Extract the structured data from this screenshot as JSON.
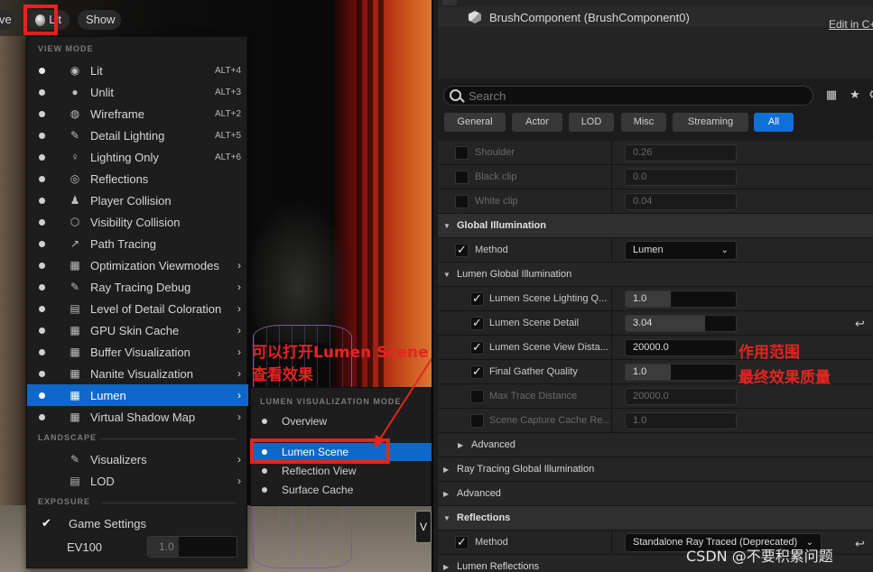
{
  "viewport": {
    "prev_label": "ve",
    "lit_label": "Lit",
    "show_label": "Show",
    "partial_button": "V"
  },
  "viewmode_menu": {
    "section_view_mode": "VIEW MODE",
    "items": [
      {
        "label": "Lit",
        "shortcut": "ALT+4",
        "icon": "sphere-icon"
      },
      {
        "label": "Unlit",
        "shortcut": "ALT+3",
        "icon": "circle-icon"
      },
      {
        "label": "Wireframe",
        "shortcut": "ALT+2",
        "icon": "globe-wire-icon"
      },
      {
        "label": "Detail Lighting",
        "shortcut": "ALT+5",
        "icon": "brush-icon"
      },
      {
        "label": "Lighting Only",
        "shortcut": "ALT+6",
        "icon": "bulb-icon"
      },
      {
        "label": "Reflections",
        "icon": "reflection-icon"
      },
      {
        "label": "Player Collision",
        "icon": "player-icon"
      },
      {
        "label": "Visibility Collision",
        "icon": "visibility-icon"
      },
      {
        "label": "Path Tracing",
        "icon": "path-icon"
      },
      {
        "label": "Optimization Viewmodes",
        "icon": "grid-icon"
      },
      {
        "label": "Ray Tracing Debug",
        "icon": "brush-icon"
      },
      {
        "label": "Level of Detail Coloration",
        "icon": "lod-icon"
      },
      {
        "label": "GPU Skin Cache",
        "icon": "grid-icon"
      },
      {
        "label": "Buffer Visualization",
        "icon": "grid-icon"
      },
      {
        "label": "Nanite Visualization",
        "icon": "grid-icon"
      },
      {
        "label": "Lumen",
        "icon": "grid-icon"
      },
      {
        "label": "Virtual Shadow Map",
        "icon": "grid-icon"
      }
    ],
    "section_landscape": "LANDSCAPE",
    "landscape_items": [
      {
        "label": "Visualizers",
        "icon": "brush-icon"
      },
      {
        "label": "LOD",
        "icon": "lod-icon"
      }
    ],
    "section_exposure": "EXPOSURE",
    "game_settings_label": "Game Settings",
    "ev100_label": "EV100",
    "ev100_value": "1.0"
  },
  "lumen_submenu": {
    "section": "LUMEN VISUALIZATION MODE",
    "items": [
      "Overview",
      "Lumen Scene",
      "Reflection View",
      "Surface Cache"
    ]
  },
  "annotations": {
    "open_scene": "可以打开Lumen Scene",
    "view_effect": "查看效果",
    "range": "作用范围",
    "quality": "最终效果质量"
  },
  "details": {
    "component_name": "BrushComponent (BrushComponent0)",
    "edit_link": "Edit in C++",
    "search_placeholder": "Search",
    "filters": [
      "General",
      "Actor",
      "LOD",
      "Misc",
      "Streaming",
      "All"
    ],
    "rows": {
      "shoulder": {
        "label": "Shoulder",
        "value": "0.26"
      },
      "black_clip": {
        "label": "Black clip",
        "value": "0.0"
      },
      "white_clip": {
        "label": "White clip",
        "value": "0.04"
      },
      "gi_header": "Global Illumination",
      "method": {
        "label": "Method",
        "value": "Lumen"
      },
      "lumen_gi_header": "Lumen Global Illumination",
      "scene_lighting_quality": {
        "label": "Lumen Scene Lighting Q...",
        "value": "1.0"
      },
      "scene_detail": {
        "label": "Lumen Scene Detail",
        "value": "3.04"
      },
      "scene_view_distance": {
        "label": "Lumen Scene View Dista...",
        "value": "20000.0"
      },
      "final_gather_quality": {
        "label": "Final Gather Quality",
        "value": "1.0"
      },
      "max_trace_distance": {
        "label": "Max Trace Distance",
        "value": "20000.0"
      },
      "scene_capture_cache": {
        "label": "Scene Capture Cache Re...",
        "value": "1.0"
      },
      "advanced_1": "Advanced",
      "rt_gi_header": "Ray Tracing Global Illumination",
      "advanced_2": "Advanced",
      "reflections_header": "Reflections",
      "refl_method": {
        "label": "Method",
        "value": "Standalone Ray Traced (Deprecated)"
      },
      "lumen_reflections_header": "Lumen Reflections"
    }
  },
  "watermark": "CSDN @不要积累问题",
  "colors": {
    "accent": "#0e68c9",
    "highlight": "#e52420"
  }
}
